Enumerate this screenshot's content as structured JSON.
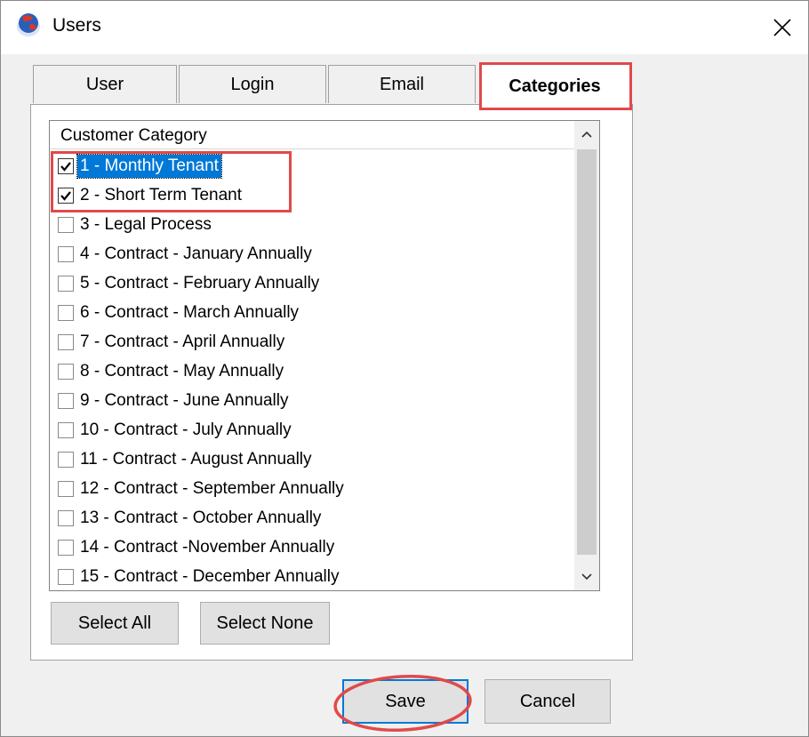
{
  "window": {
    "title": "Users",
    "close_glyph": "✕"
  },
  "tabs": [
    {
      "label": "User",
      "active": false
    },
    {
      "label": "Login",
      "active": false
    },
    {
      "label": "Email",
      "active": false
    },
    {
      "label": "Categories",
      "active": true
    }
  ],
  "list": {
    "header": "Customer Category",
    "items": [
      {
        "label": "1 - Monthly Tenant",
        "checked": true,
        "selected": true
      },
      {
        "label": "2 - Short Term Tenant",
        "checked": true,
        "selected": false
      },
      {
        "label": "3 - Legal Process",
        "checked": false,
        "selected": false
      },
      {
        "label": "4 - Contract - January Annually",
        "checked": false,
        "selected": false
      },
      {
        "label": "5 - Contract - February Annually",
        "checked": false,
        "selected": false
      },
      {
        "label": "6 - Contract - March Annually",
        "checked": false,
        "selected": false
      },
      {
        "label": "7 - Contract - April Annually",
        "checked": false,
        "selected": false
      },
      {
        "label": "8 - Contract - May Annually",
        "checked": false,
        "selected": false
      },
      {
        "label": "9 - Contract - June Annually",
        "checked": false,
        "selected": false
      },
      {
        "label": "10 - Contract - July Annually",
        "checked": false,
        "selected": false
      },
      {
        "label": "11 - Contract - August Annually",
        "checked": false,
        "selected": false
      },
      {
        "label": "12 - Contract - September Annually",
        "checked": false,
        "selected": false
      },
      {
        "label": "13 - Contract - October Annually",
        "checked": false,
        "selected": false
      },
      {
        "label": "14 - Contract -November Annually",
        "checked": false,
        "selected": false
      },
      {
        "label": "15 - Contract - December Annually",
        "checked": false,
        "selected": false
      }
    ]
  },
  "buttons": {
    "select_all": "Select All",
    "select_none": "Select None",
    "save": "Save",
    "cancel": "Cancel"
  },
  "colors": {
    "highlight": "#e04a4a",
    "selection": "#0078d7"
  }
}
